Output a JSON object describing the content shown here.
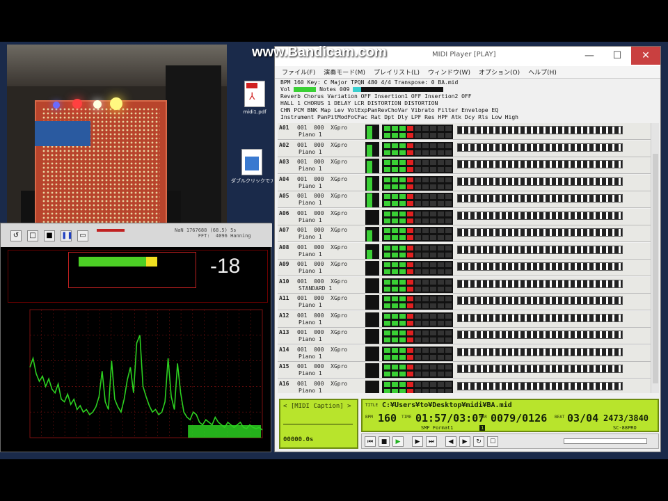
{
  "watermark": "www.Bandicam.com",
  "desktop_icons": [
    {
      "label": "midi1.pdf",
      "icon": "pdf-file-icon"
    },
    {
      "label": "ダブルクリックでアイコンを開くファイル",
      "icon": "document-icon"
    }
  ],
  "analyzer": {
    "meter_value": "-18",
    "meter_level": 0.62,
    "toolbar_info": "NaN 1767688 (68.5) 5s\n        FFT:  4096 Hanning",
    "toolbar_buttons": [
      "undo",
      "square",
      "stop",
      "pause",
      "window"
    ]
  },
  "player": {
    "title": "MIDI Player [PLAY]",
    "window_buttons": [
      "—",
      "☐",
      "✕"
    ],
    "menu": [
      "ファイル(F)",
      "演奏モード(M)",
      "プレイリスト(L)",
      "ウィンドウ(W)",
      "オプション(O)",
      "ヘルプ(H)"
    ],
    "info": {
      "line1": "BPM 160  Key: C  Major  TPQN 480  4/4  Transpose: 0  BA.mid",
      "vol_label": "Vol",
      "notes_label": "Notes 009",
      "line3": "Reverb          Chorus          Variation  OFF  Insertion1  OFF  Insertion2  OFF",
      "line4": "HALL 1          CHORUS 1        DELAY LCR      DISTORTION      DISTORTION",
      "line5": "CHN PCM BNK Map  Lev VolExpPanRevChoVar   Vibrato   Filter   Envelope  EQ",
      "line6": "    Instrument        PanPitModFoCFac  Rat Dpt Dly LPF Res HPF Atk Dcy Rls Low High"
    },
    "channels": [
      {
        "ch": "A01",
        "prog": "001  000  XGpro",
        "inst": "Piano 1",
        "lev": 0.9
      },
      {
        "ch": "A02",
        "prog": "001  000  XGpro",
        "inst": "Piano 1",
        "lev": 0.8
      },
      {
        "ch": "A03",
        "prog": "001  000  XGpro",
        "inst": "Piano 1",
        "lev": 0.85
      },
      {
        "ch": "A04",
        "prog": "001  000  XGpro",
        "inst": "Piano 1",
        "lev": 0.9
      },
      {
        "ch": "A05",
        "prog": "001  000  XGpro",
        "inst": "Piano 1",
        "lev": 0.95
      },
      {
        "ch": "A06",
        "prog": "001  000  XGpro",
        "inst": "Piano 1",
        "lev": 0.0
      },
      {
        "ch": "A07",
        "prog": "001  000  XGpro",
        "inst": "Piano 1",
        "lev": 0.75
      },
      {
        "ch": "A08",
        "prog": "001  000  XGpro",
        "inst": "Piano 1",
        "lev": 0.6
      },
      {
        "ch": "A09",
        "prog": "001  000  XGpro",
        "inst": "Piano 1",
        "lev": 0.0
      },
      {
        "ch": "A10",
        "prog": "001  000  XGpro",
        "inst": "STANDARD 1",
        "lev": 0.0
      },
      {
        "ch": "A11",
        "prog": "001  000  XGpro",
        "inst": "Piano 1",
        "lev": 0.0
      },
      {
        "ch": "A12",
        "prog": "001  000  XGpro",
        "inst": "Piano 1",
        "lev": 0.0
      },
      {
        "ch": "A13",
        "prog": "001  000  XGpro",
        "inst": "Piano 1",
        "lev": 0.0
      },
      {
        "ch": "A14",
        "prog": "001  000  XGpro",
        "inst": "Piano 1",
        "lev": 0.0
      },
      {
        "ch": "A15",
        "prog": "001  000  XGpro",
        "inst": "Piano 1",
        "lev": 0.0
      },
      {
        "ch": "A16",
        "prog": "001  000  XGpro",
        "inst": "Piano 1",
        "lev": 0.0
      }
    ],
    "lcd_left": {
      "title": "< [MIDI Caption] >",
      "counter": "00000.0s"
    },
    "lcd_right": {
      "title_label": "TITLE",
      "path": "C:¥Users¥to¥Desktop¥midi¥BA.mid",
      "bpm_label": "BPM",
      "bpm": "160",
      "time_label": "TIME",
      "time": "01:57/03:07",
      "bar_label": "BAR",
      "bar": "0079/0126",
      "beat_label": "BEAT",
      "beat": "03/04",
      "tick": "2473/3840",
      "format": "SMF Format1",
      "format_num": "1",
      "device": "SC-88PRO"
    },
    "transport": [
      "⏮",
      "■",
      "▶",
      "▶",
      "⏭",
      "◀",
      "▶",
      "↻",
      "☐"
    ]
  },
  "colors": {
    "meter_green": "#4cd025",
    "spectrum_green": "#2cd020",
    "lcd_green": "#b8e42c",
    "grid_red": "#7a1010"
  },
  "spectrum_data": [
    0.55,
    0.62,
    0.5,
    0.44,
    0.48,
    0.4,
    0.46,
    0.38,
    0.35,
    0.42,
    0.3,
    0.28,
    0.34,
    0.26,
    0.3,
    0.22,
    0.25,
    0.2,
    0.22,
    0.18,
    0.2,
    0.24,
    0.32,
    0.52,
    0.28,
    0.22,
    0.6,
    0.3,
    0.24,
    0.2,
    0.3,
    0.45,
    0.55,
    0.35,
    0.74,
    0.8,
    0.4,
    0.32,
    0.25,
    0.2,
    0.22,
    0.18,
    0.2,
    0.28,
    0.62,
    0.32,
    0.22,
    0.58,
    0.35,
    0.2,
    0.16,
    0.14,
    0.2,
    0.18,
    0.12,
    0.1,
    0.14,
    0.12,
    0.1,
    0.16,
    0.12,
    0.1,
    0.08,
    0.12,
    0.1,
    0.08,
    0.1,
    0.12,
    0.08,
    0.07,
    0.1,
    0.08,
    0.07,
    0.08,
    0.06
  ]
}
